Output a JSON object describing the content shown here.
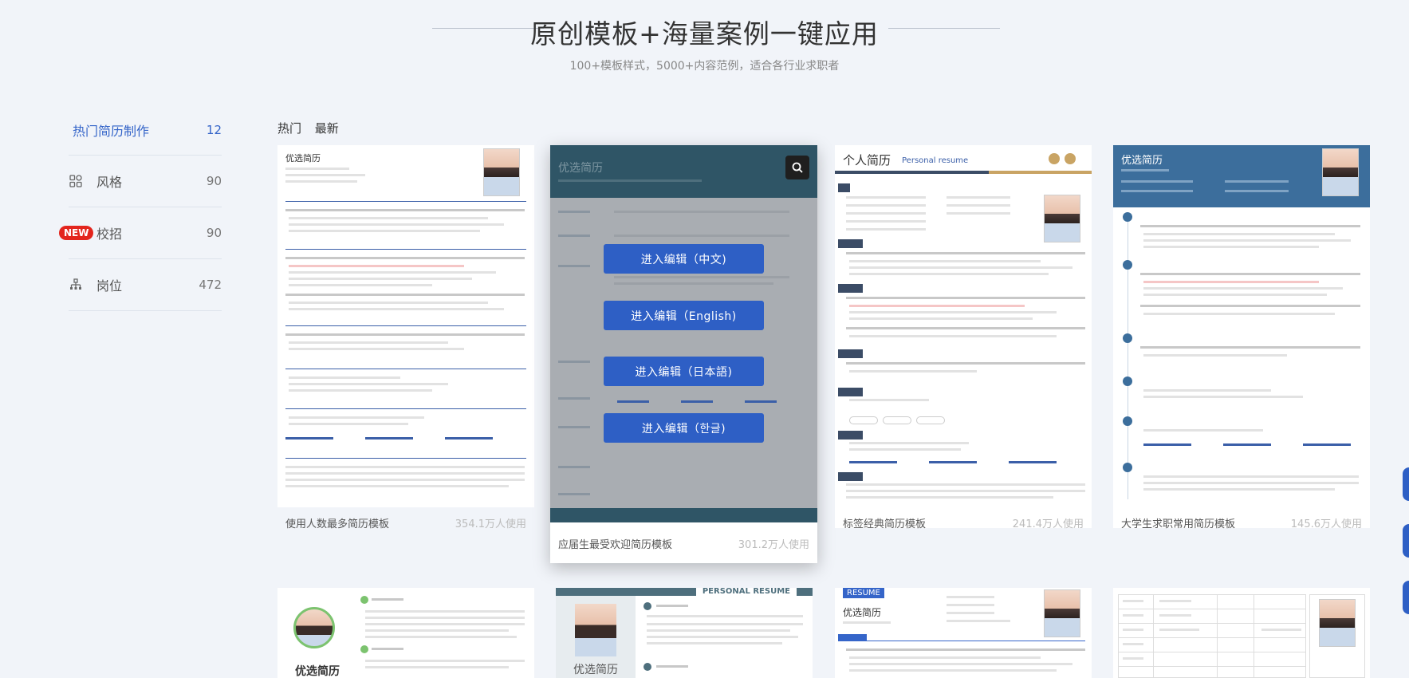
{
  "header": {
    "title": "原创模板+海量案例一键应用",
    "subtitle": "100+模板样式，5000+内容范例，适合各行业求职者"
  },
  "sidebar": {
    "items": [
      {
        "label": "热门简历制作",
        "count": "12",
        "icon": "none"
      },
      {
        "label": "风格",
        "count": "90",
        "icon": "grid-icon"
      },
      {
        "label": "校招",
        "count": "90",
        "icon": "new-badge",
        "badge": "NEW"
      },
      {
        "label": "岗位",
        "count": "472",
        "icon": "org-chart-icon"
      }
    ]
  },
  "tabs": [
    "热门",
    "最新"
  ],
  "cards": [
    {
      "name": "使用人数最多简历模板",
      "uses": "354.1万人使用",
      "resume_title": "优选简历"
    },
    {
      "name": "应届生最受欢迎简历模板",
      "uses": "301.2万人使用",
      "resume_title": "优选简历"
    },
    {
      "name": "标签经典简历模板",
      "uses": "241.4万人使用",
      "resume_title": "个人简历",
      "resume_subtitle": "Personal resume"
    },
    {
      "name": "大学生求职常用简历模板",
      "uses": "145.6万人使用",
      "resume_title": "优选简历"
    }
  ],
  "overlay": {
    "buttons": [
      "进入编辑（中文)",
      "进入编辑（English)",
      "进入编辑（日本語)",
      "进入编辑（한글)"
    ]
  },
  "row2": {
    "card1_title": "优选简历",
    "card2_banner": "PERSONAL RESUME",
    "card2_title": "优选简历",
    "card3_badge": "RESUME",
    "card3_title": "优选简历"
  },
  "colors": {
    "accent": "#2e5fc5",
    "background": "#f1f4f9",
    "badge": "#e3251d",
    "hover_band": "#2f5566"
  }
}
